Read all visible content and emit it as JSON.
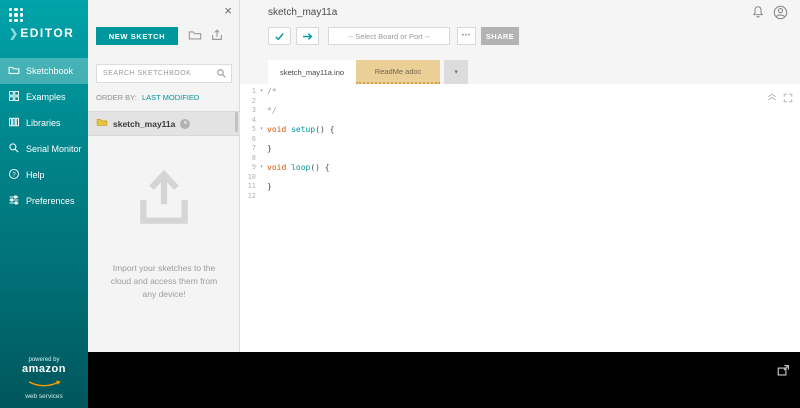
{
  "app": {
    "logo_chevron": "❯",
    "logo_text": "EDITOR"
  },
  "icons": {
    "close": "×",
    "caret_down": "▾",
    "fold": "▾",
    "more_dots": "•••",
    "badge_x": "×"
  },
  "colors": {
    "accent_teal": "#00979c",
    "readme_tab_bg": "#ead097",
    "console_bg": "#000000",
    "sidebar_teal": "#00868c"
  },
  "sidebar": {
    "items": [
      {
        "label": "Sketchbook"
      },
      {
        "label": "Examples"
      },
      {
        "label": "Libraries"
      },
      {
        "label": "Serial Monitor"
      },
      {
        "label": "Help"
      },
      {
        "label": "Preferences"
      }
    ],
    "footer": {
      "powered_by": "powered by",
      "brand": "amazon",
      "sub": "web services"
    }
  },
  "sketch_panel": {
    "new_sketch_label": "NEW SKETCH",
    "search_placeholder": "SEARCH SKETCHBOOK",
    "order_by_label": "ORDER BY:",
    "order_by_value": "LAST MODIFIED",
    "sketches": [
      {
        "name": "sketch_may11a"
      }
    ],
    "import_message": "Import your sketches to the cloud and access them from any device!"
  },
  "header": {
    "title": "sketch_may11a"
  },
  "toolbar": {
    "board_select_value": "-- Select Board or Port --",
    "share_label": "SHARE"
  },
  "tabs": [
    {
      "label": "sketch_may11a.ino"
    },
    {
      "label": "ReadMe adoc"
    }
  ],
  "editor": {
    "lines": [
      {
        "n": "1",
        "fold": true,
        "tokens": [
          {
            "t": "/*",
            "c": "comment"
          }
        ]
      },
      {
        "n": "2",
        "tokens": []
      },
      {
        "n": "3",
        "tokens": [
          {
            "t": "*/",
            "c": "comment"
          }
        ]
      },
      {
        "n": "4",
        "tokens": []
      },
      {
        "n": "5",
        "fold": true,
        "tokens": [
          {
            "t": "void",
            "c": "keyword"
          },
          {
            "t": " ",
            "c": "plain"
          },
          {
            "t": "setup",
            "c": "function"
          },
          {
            "t": "() {",
            "c": "plain"
          }
        ]
      },
      {
        "n": "6",
        "tokens": []
      },
      {
        "n": "7",
        "tokens": [
          {
            "t": "}",
            "c": "plain"
          }
        ]
      },
      {
        "n": "8",
        "tokens": []
      },
      {
        "n": "9",
        "fold": true,
        "tokens": [
          {
            "t": "void",
            "c": "keyword"
          },
          {
            "t": " ",
            "c": "plain"
          },
          {
            "t": "loop",
            "c": "function"
          },
          {
            "t": "() {",
            "c": "plain"
          }
        ]
      },
      {
        "n": "10",
        "tokens": []
      },
      {
        "n": "11",
        "tokens": [
          {
            "t": "}",
            "c": "plain"
          }
        ]
      },
      {
        "n": "12",
        "tokens": []
      }
    ]
  }
}
